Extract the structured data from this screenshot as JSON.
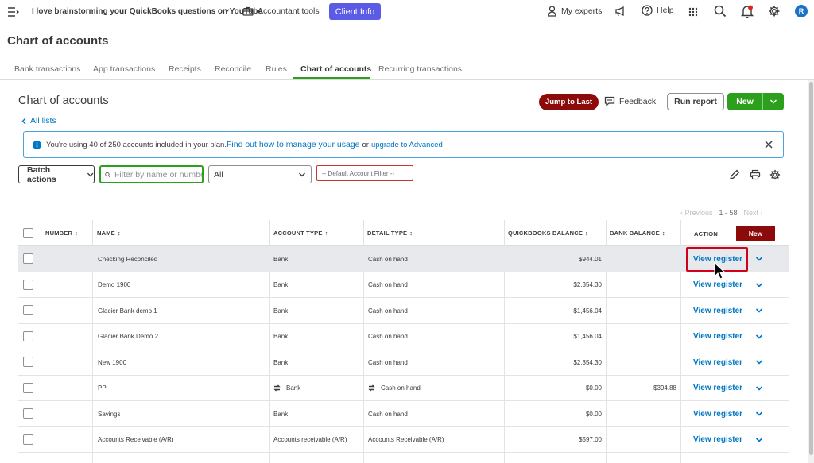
{
  "topbar": {
    "company": "I love brainstorming your QuickBooks questions on YouTube",
    "accountant_tools": "Accountant tools",
    "client_info": "Client Info",
    "my_experts": "My experts",
    "help": "Help",
    "avatar_letter": "R"
  },
  "page": {
    "title": "Chart of accounts"
  },
  "tabs": [
    "Bank transactions",
    "App transactions",
    "Receipts",
    "Reconcile",
    "Rules",
    "Chart of accounts",
    "Recurring transactions"
  ],
  "active_tab": "Chart of accounts",
  "content": {
    "title": "Chart of accounts",
    "all_lists": "All lists",
    "jump_to_last": "Jump to Last",
    "feedback": "Feedback",
    "run_report": "Run report",
    "new": "New"
  },
  "banner": {
    "text": "You're using 40 of 250 accounts included in your plan.",
    "link": "Find out how to manage your usage",
    "or": "or",
    "upgrade": "upgrade to Advanced"
  },
  "filters": {
    "batch_actions": "Batch actions",
    "filter_placeholder": "Filter by name or number",
    "type_value": "All",
    "default_filter": "-- Default Account Filter --"
  },
  "pager": {
    "previous": "Previous",
    "range": "1 - 58",
    "next": "Next"
  },
  "columns": {
    "number": "NUMBER",
    "name": "NAME",
    "account_type": "ACCOUNT TYPE",
    "detail_type": "DETAIL TYPE",
    "qb_balance": "QUICKBOOKS BALANCE",
    "bank_balance": "BANK BALANCE",
    "action": "ACTION",
    "new_button": "New"
  },
  "rows": [
    {
      "name": "Checking Reconciled",
      "account_type": "Bank",
      "detail_type": "Cash on hand",
      "qb_balance": "$944.01",
      "bank_balance": "",
      "action": "View register"
    },
    {
      "name": "Demo 1900",
      "account_type": "Bank",
      "detail_type": "Cash on hand",
      "qb_balance": "$2,354.30",
      "bank_balance": "",
      "action": "View register"
    },
    {
      "name": "Glacier Bank demo 1",
      "account_type": "Bank",
      "detail_type": "Cash on hand",
      "qb_balance": "$1,456.04",
      "bank_balance": "",
      "action": "View register"
    },
    {
      "name": "Glacier Bank Demo 2",
      "account_type": "Bank",
      "detail_type": "Cash on hand",
      "qb_balance": "$1,456.04",
      "bank_balance": "",
      "action": "View register"
    },
    {
      "name": "New 1900",
      "account_type": "Bank",
      "detail_type": "Cash on hand",
      "qb_balance": "$2,354.30",
      "bank_balance": "",
      "action": "View register"
    },
    {
      "name": "PP",
      "account_type": "Bank",
      "detail_type": "Cash on hand",
      "qb_balance": "$0.00",
      "bank_balance": "$394.88",
      "action": "View register"
    },
    {
      "name": "Savings",
      "account_type": "Bank",
      "detail_type": "Cash on hand",
      "qb_balance": "$0.00",
      "bank_balance": "",
      "action": "View register"
    },
    {
      "name": "Accounts Receivable (A/R)",
      "account_type": "Accounts receivable (A/R)",
      "detail_type": "Accounts Receivable (A/R)",
      "qb_balance": "$597.00",
      "bank_balance": "",
      "action": "View register"
    }
  ],
  "colors": {
    "brand_green": "#2ca01c",
    "link_blue": "#0077c5",
    "dark_red": "#8d0a0a",
    "client_purple": "#5c5be5",
    "highlight_red": "#d0021b"
  }
}
